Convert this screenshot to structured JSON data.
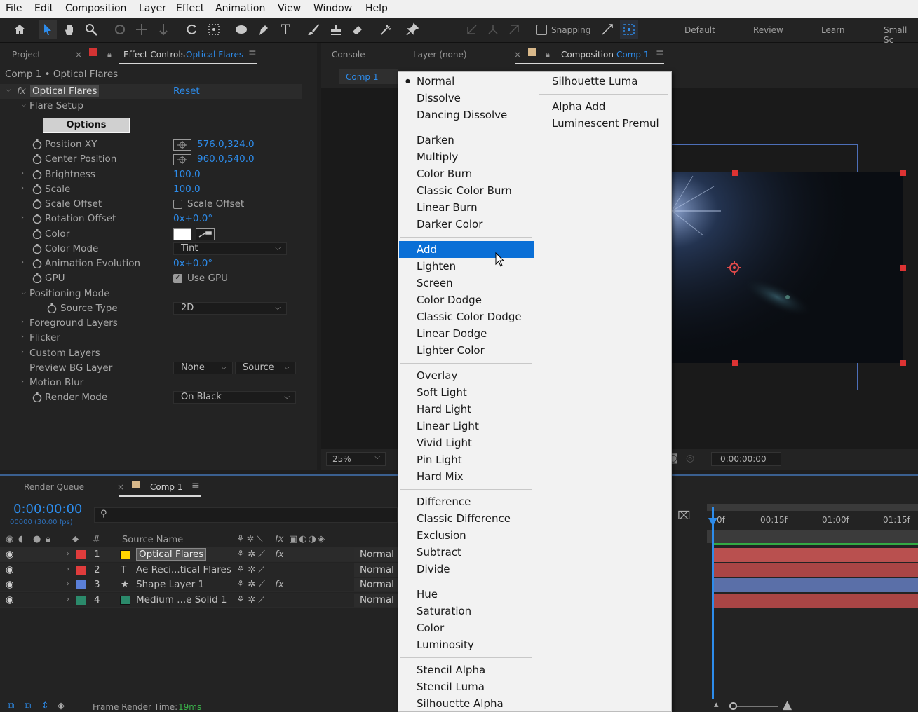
{
  "menubar": [
    "File",
    "Edit",
    "Composition",
    "Layer",
    "Effect",
    "Animation",
    "View",
    "Window",
    "Help"
  ],
  "toolbar": {
    "snapping": "Snapping",
    "workspaces": [
      "Default",
      "Review",
      "Learn",
      "Small Sc"
    ]
  },
  "left_panel": {
    "tab_project": "Project",
    "tab_effect_controls": "Effect Controls",
    "tab_effect_target": "Optical Flares",
    "breadcrumb": "Comp 1 • Optical Flares",
    "fx_label": "fx",
    "effect_name": "Optical Flares",
    "reset": "Reset",
    "flare_setup": "Flare Setup",
    "options_button": "Options",
    "props": [
      {
        "label": "Position XY",
        "value": "576.0,324.0"
      },
      {
        "label": "Center Position",
        "value": "960.0,540.0"
      },
      {
        "label": "Brightness",
        "value": "100.0"
      },
      {
        "label": "Scale",
        "value": "100.0"
      },
      {
        "label": "Scale Offset",
        "value": "Scale Offset"
      },
      {
        "label": "Rotation Offset",
        "value": "0x+0.0°"
      },
      {
        "label": "Color",
        "value": ""
      },
      {
        "label": "Color Mode",
        "value": "Tint"
      },
      {
        "label": "Animation Evolution",
        "value": "0x+0.0°"
      },
      {
        "label": "GPU",
        "value": "Use GPU"
      }
    ],
    "positioning_mode": "Positioning Mode",
    "source_type": {
      "label": "Source Type",
      "value": "2D"
    },
    "foreground_layers": "Foreground Layers",
    "flicker": "Flicker",
    "custom_layers": "Custom Layers",
    "preview_bg": {
      "label": "Preview BG Layer",
      "value1": "None",
      "value2": "Source"
    },
    "motion_blur": "Motion Blur",
    "render_mode": {
      "label": "Render Mode",
      "value": "On Black"
    }
  },
  "viewer_panel": {
    "tab_console": "Console",
    "tab_layer": "Layer (none)",
    "tab_composition": "Composition",
    "tab_comp_name": "Comp 1",
    "comp_chip": "Comp 1",
    "zoom": "25%",
    "timecode": "0:00:00:00"
  },
  "timeline": {
    "tab_render_queue": "Render Queue",
    "tab_comp": "Comp 1",
    "timecode": "0:00:00:00",
    "frames": "00000 (30.00 fps)",
    "col_num": "#",
    "col_source": "Source Name",
    "ruler": [
      "0f",
      "00:15f",
      "01:00f",
      "01:15f"
    ],
    "layers": [
      {
        "num": "1",
        "type": "solid",
        "name": "Optical Flares",
        "mode": "Normal",
        "label_color": "#ffd400",
        "bar_color": "#b9504f"
      },
      {
        "num": "2",
        "type": "text",
        "name": "Ae Reci...tical Flares",
        "mode": "Normal",
        "label_color": "#e03c3c",
        "bar_color": "#a94545"
      },
      {
        "num": "3",
        "type": "shape",
        "name": "Shape Layer 1",
        "mode": "Normal",
        "label_color": "#5a7fd8",
        "bar_color": "#5a6fa8"
      },
      {
        "num": "4",
        "type": "solid",
        "name": "Medium ...e Solid 1",
        "mode": "Normal",
        "label_color": "#2b8a6b",
        "bar_color": "#a94545"
      }
    ],
    "frame_render_label": "Frame Render Time:",
    "frame_render_value": "19ms"
  },
  "blend_menu": {
    "selected": "Add",
    "col1_groups": [
      [
        "Normal",
        "Dissolve",
        "Dancing Dissolve"
      ],
      [
        "Darken",
        "Multiply",
        "Color Burn",
        "Classic Color Burn",
        "Linear Burn",
        "Darker Color"
      ],
      [
        "Add",
        "Lighten",
        "Screen",
        "Color Dodge",
        "Classic Color Dodge",
        "Linear Dodge",
        "Lighter Color"
      ],
      [
        "Overlay",
        "Soft Light",
        "Hard Light",
        "Linear Light",
        "Vivid Light",
        "Pin Light",
        "Hard Mix"
      ],
      [
        "Difference",
        "Classic Difference",
        "Exclusion",
        "Subtract",
        "Divide"
      ],
      [
        "Hue",
        "Saturation",
        "Color",
        "Luminosity"
      ],
      [
        "Stencil Alpha",
        "Stencil Luma",
        "Silhouette Alpha"
      ]
    ],
    "col2_groups": [
      [
        "Silhouette Luma"
      ],
      [
        "Alpha Add",
        "Luminescent Premul"
      ]
    ]
  },
  "colors": {
    "accent": "#2d8ceb",
    "selection": "#0a6fd6",
    "handle": "#d33333"
  }
}
